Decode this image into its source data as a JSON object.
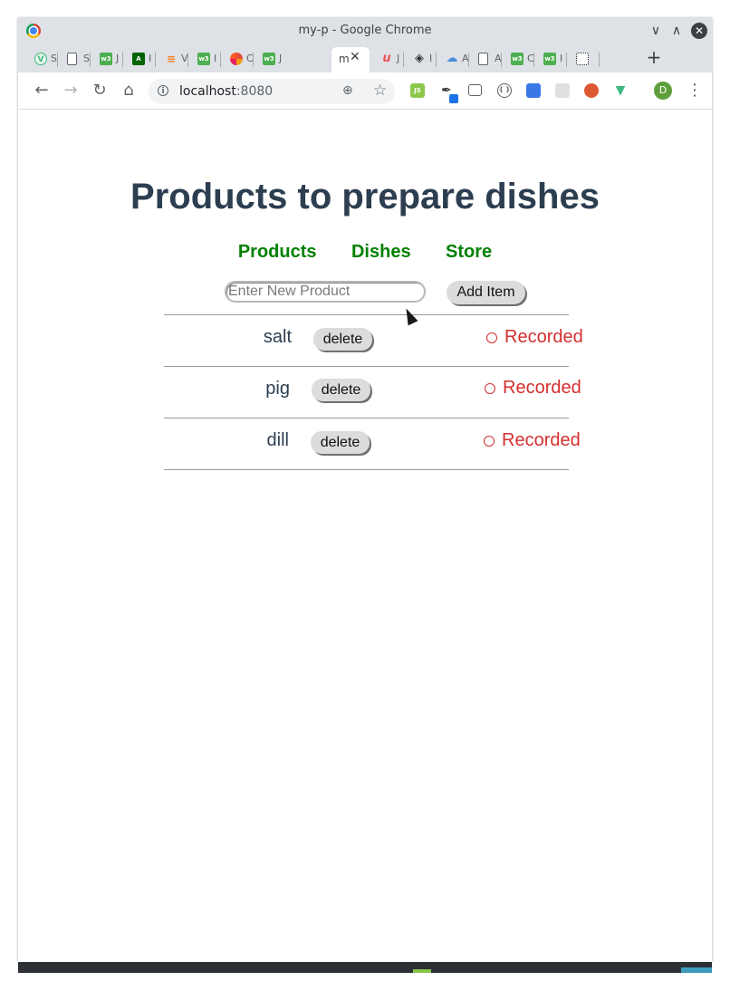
{
  "window": {
    "title": "my-p - Google Chrome"
  },
  "tabs": [
    {
      "icon": "vuejs-icon",
      "text": "S",
      "color": "#41b883"
    },
    {
      "icon": "page-icon",
      "text": "S",
      "color": "#ffffff"
    },
    {
      "icon": "w3schools-icon",
      "text": "J",
      "color": "#4caf50"
    },
    {
      "icon": "angular-icon",
      "text": "I",
      "color": "#006400"
    },
    {
      "icon": "stackoverflow-icon",
      "text": "V",
      "color": "#f48024"
    },
    {
      "icon": "w3schools-icon",
      "text": "I",
      "color": "#4caf50"
    },
    {
      "icon": "colorful-icon",
      "text": "C",
      "color": "#e74c3c"
    },
    {
      "icon": "w3schools-icon",
      "text": "J",
      "color": "#4caf50"
    },
    {
      "icon": "",
      "text": "m",
      "color": "#ffffff",
      "active": true
    },
    {
      "icon": "udemy-icon",
      "text": "J",
      "color": "#ec5252"
    },
    {
      "icon": "codepen-icon",
      "text": "I",
      "color": "#333333"
    },
    {
      "icon": "cloud-icon",
      "text": "A",
      "color": "#4a90d9"
    },
    {
      "icon": "page-icon",
      "text": "A",
      "color": "#ffffff"
    },
    {
      "icon": "w3schools-icon",
      "text": "C",
      "color": "#4caf50"
    },
    {
      "icon": "w3schools-icon",
      "text": "I",
      "color": "#4caf50"
    },
    {
      "icon": "realhowto-icon",
      "text": "",
      "color": "#222222"
    }
  ],
  "omnibox": {
    "host": "localhost",
    "port": ":8080"
  },
  "extensions": [
    {
      "name": "nodejs-icon",
      "color": "#8cc84b",
      "glyph": "JS"
    },
    {
      "name": "eyedropper-icon",
      "color": "#1a73e8",
      "glyph": ""
    },
    {
      "name": "screenshot-icon",
      "color": "#5f6368",
      "glyph": ""
    },
    {
      "name": "braces-icon",
      "color": "#5f6368",
      "glyph": "{ }"
    },
    {
      "name": "reader-icon",
      "color": "#3b78e7",
      "glyph": ""
    },
    {
      "name": "react-icon",
      "color": "#cccccc",
      "glyph": ""
    },
    {
      "name": "duckduckgo-icon",
      "color": "#de5833",
      "glyph": ""
    },
    {
      "name": "vue-devtools-icon",
      "color": "#41b883",
      "glyph": "V"
    }
  ],
  "profile": {
    "initial": "D"
  },
  "app": {
    "title": "Products to prepare dishes",
    "nav": [
      "Products",
      "Dishes",
      "Store"
    ],
    "input_placeholder": "Enter New Product",
    "add_button": "Add Item",
    "status_label": "Recorded",
    "products": [
      {
        "name": "salt",
        "delete_label": "delete"
      },
      {
        "name": "pig",
        "delete_label": "delete"
      },
      {
        "name": "dill",
        "delete_label": "delete"
      }
    ]
  }
}
